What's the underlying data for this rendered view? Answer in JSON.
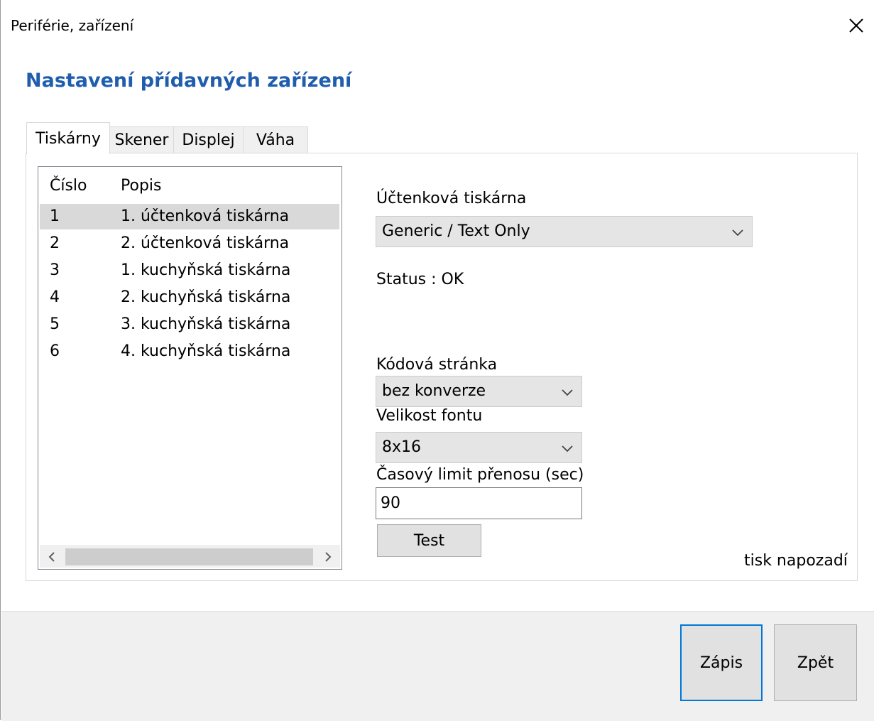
{
  "window": {
    "title": "Periférie, zařízení",
    "close_icon": "close-icon"
  },
  "heading": "Nastavení přídavných zařízení",
  "tabs": [
    {
      "label": "Tiskárny",
      "active": true
    },
    {
      "label": "Skener",
      "active": false
    },
    {
      "label": "Displej",
      "active": false
    },
    {
      "label": "Váha",
      "active": false
    }
  ],
  "printer_list": {
    "columns": [
      "Číslo",
      "Popis"
    ],
    "rows": [
      {
        "number": "1",
        "description": "1. účtenková tiskárna",
        "selected": true
      },
      {
        "number": "2",
        "description": "2. účtenková tiskárna",
        "selected": false
      },
      {
        "number": "3",
        "description": "1. kuchyňská tiskárna",
        "selected": false
      },
      {
        "number": "4",
        "description": "2. kuchyňská tiskárna",
        "selected": false
      },
      {
        "number": "5",
        "description": "3. kuchyňská tiskárna",
        "selected": false
      },
      {
        "number": "6",
        "description": "4. kuchyňská tiskárna",
        "selected": false
      }
    ],
    "scroll_left_icon": "chevron-left-icon",
    "scroll_right_icon": "chevron-right-icon"
  },
  "settings": {
    "printer_label": "Účtenková tiskárna",
    "printer_value": "Generic / Text Only",
    "status": "Status : OK",
    "codepage_label": "Kódová stránka",
    "codepage_value": "bez konverze",
    "font_size_label": "Velikost fontu",
    "font_size_value": "8x16",
    "timeout_label": "Časový limit přenosu (sec)",
    "timeout_value": "90",
    "test_button": "Test",
    "background_print": "tisk napozadí"
  },
  "footer": {
    "save_button": "Zápis",
    "back_button": "Zpět"
  },
  "colors": {
    "heading": "#1f5dad",
    "selected_row": "#d9d9d9",
    "footer_bg": "#f0f0f0",
    "primary_border": "#0078d7"
  }
}
